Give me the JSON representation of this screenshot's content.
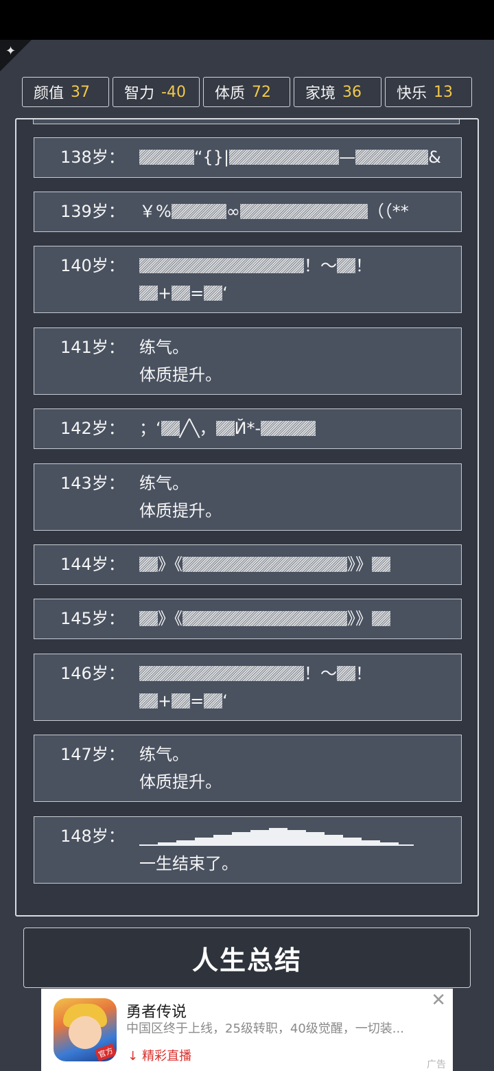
{
  "attributes": [
    {
      "name": "颜值",
      "value": "37"
    },
    {
      "name": "智力",
      "value": "-40"
    },
    {
      "name": "体质",
      "value": "72"
    },
    {
      "name": "家境",
      "value": "36"
    },
    {
      "name": "快乐",
      "value": "13"
    }
  ],
  "events": [
    {
      "age": "138岁：",
      "line1": "“{}|",
      "line1_b": "—",
      "line1_c": "&"
    },
    {
      "age": "139岁：",
      "line1": "￥%",
      "line1_b": "∞",
      "line1_c": "（（**"
    },
    {
      "age": "140岁：",
      "line1": "！～",
      "line1_b": "！",
      "line2": "+",
      "line2_b": "=",
      "line2_c": "‘"
    },
    {
      "age": "141岁：",
      "line1": "练气。",
      "line2": "体质提升。"
    },
    {
      "age": "142岁：",
      "line1": "；‘",
      "line1_b": "╱╲，",
      "line1_c": "Й*-"
    },
    {
      "age": "143岁：",
      "line1": "练气。",
      "line2": "体质提升。"
    },
    {
      "age": "144岁：",
      "line1": "》《",
      "line1_b": "》》"
    },
    {
      "age": "145岁：",
      "line1": "》《",
      "line1_b": "》》"
    },
    {
      "age": "146岁：",
      "line1": "！～",
      "line1_b": "！",
      "line2": "+",
      "line2_b": "=",
      "line2_c": "‘"
    },
    {
      "age": "147岁：",
      "line1": "练气。",
      "line2": "体质提升。"
    },
    {
      "age": "148岁：",
      "line2": "一生结束了。"
    }
  ],
  "summary_button": "人生总结",
  "ad": {
    "title": "勇者传说",
    "description": "中国区终于上线，25级转职，40级觉醒，一切装...",
    "cta": "精彩直播",
    "icon_badge": "官方",
    "mark": "广告",
    "close": "✕"
  },
  "icons": {
    "corner": "sparkle-icon",
    "cta_arrow": "download-arrow-icon",
    "ad_close": "close-icon"
  }
}
